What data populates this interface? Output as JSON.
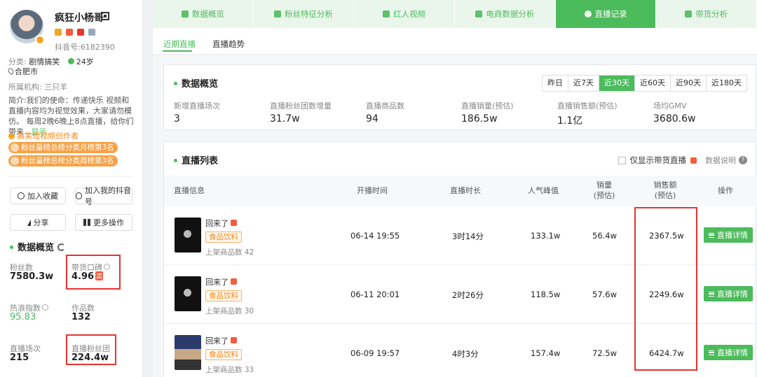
{
  "profile": {
    "name": "疯狂小杨哥",
    "douyin_id": "抖音号:6182390",
    "category_label": "分类:",
    "category": "剧情搞笑",
    "age": "24岁",
    "location": "合肥市",
    "agency": "所属机构: 三只羊",
    "intro": "简介:我们的使命：传递快乐 视频和直播内容均为视觉效果，大家请勿模仿。 每周2晚6晚上8点直播，给你们带来",
    "intro_more": "...显示",
    "creator_badge": "搞笑短视频创作者",
    "rank_tags": [
      "粉丝量榜总榜分类月榜第3名",
      "粉丝量榜总榜分类周榜第3名"
    ]
  },
  "actions": {
    "favorite": "加入收藏",
    "add_mine": "加入我的抖音号",
    "share": "分享",
    "more": "更多操作"
  },
  "overview": {
    "title": "数据概览",
    "fans_label": "粉丝数",
    "fans_value": "7580.3w",
    "reputation_label": "带货口碑",
    "reputation_value": "4.96",
    "reputation_tag": "高",
    "heat_label": "热浪指数",
    "heat_value": "95.83",
    "works_label": "作品数",
    "works_value": "132",
    "live_count_label": "直播场次",
    "live_count_value": "215",
    "fan_group_label": "直播粉丝团",
    "fan_group_value": "224.4w"
  },
  "topnav": [
    "数据概览",
    "粉丝特征分析",
    "红人视频",
    "电商数据分析",
    "直播记录",
    "带货分析"
  ],
  "subtabs": [
    "近期直播",
    "直播趋势"
  ],
  "live_overview": {
    "title": "数据概览",
    "ranges": [
      "昨日",
      "近7天",
      "近30天",
      "近60天",
      "近90天",
      "近180天"
    ],
    "kpis": [
      {
        "label": "新增直播场次",
        "value": "3"
      },
      {
        "label": "直播粉丝团数增量",
        "value": "31.7w"
      },
      {
        "label": "直播商品数",
        "value": "94"
      },
      {
        "label": "直播销量(预估)",
        "value": "186.5w"
      },
      {
        "label": "直播销售额(预估)",
        "value": "1.1亿"
      },
      {
        "label": "场均GMV",
        "value": "3680.6w"
      }
    ]
  },
  "live_list": {
    "title": "直播列表",
    "only_goods": "仅显示带货直播",
    "data_note": "数据说明",
    "headers": {
      "info": "直播信息",
      "start": "开播时间",
      "duration": "直播时长",
      "peak": "人气峰值",
      "sales_1": "销量",
      "sales_2": "(预估)",
      "amount_1": "销售额",
      "amount_2": "(预估)",
      "op": "操作"
    },
    "detail_label": "直播详情",
    "rows": [
      {
        "title": "回来了",
        "tag": "食品饮料",
        "goods": "上架商品数 42",
        "start": "06-14 19:55",
        "duration": "3时14分",
        "peak": "133.1w",
        "sales": "56.4w",
        "amount": "2367.5w"
      },
      {
        "title": "回来了",
        "tag": "食品饮料",
        "goods": "上架商品数 30",
        "start": "06-11 20:01",
        "duration": "2时26分",
        "peak": "118.5w",
        "sales": "57.6w",
        "amount": "2249.6w"
      },
      {
        "title": "回来了",
        "tag": "食品饮料",
        "goods": "上架商品数 33",
        "start": "06-09 19:57",
        "duration": "4时3分",
        "peak": "157.4w",
        "sales": "72.5w",
        "amount": "6424.7w"
      }
    ]
  },
  "colors": {
    "accent": "#4cbb5c",
    "highlight_box": "#e8332e",
    "tag_orange": "#f7a247"
  }
}
